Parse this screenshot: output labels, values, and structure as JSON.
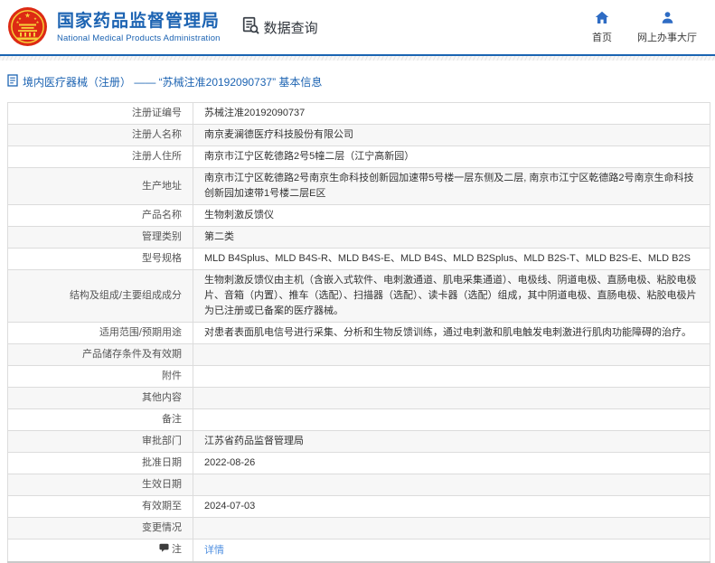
{
  "header": {
    "org_name_cn": "国家药品监督管理局",
    "org_name_en": "National Medical Products Administration",
    "app_title": "数据查询",
    "nav_home_label": "首页",
    "nav_hall_label": "网上办事大厅"
  },
  "breadcrumb": {
    "text": "境内医疗器械（注册） —— “苏械注准20192090737” 基本信息"
  },
  "table": {
    "rows": [
      {
        "label": "注册证编号",
        "value": "苏械注准20192090737"
      },
      {
        "label": "注册人名称",
        "value": "南京麦澜德医疗科技股份有限公司"
      },
      {
        "label": "注册人住所",
        "value": "南京市江宁区乾德路2号5幢二层（江宁高新园）"
      },
      {
        "label": "生产地址",
        "value": "南京市江宁区乾德路2号南京生命科技创新园加速带5号楼一层东侧及二层, 南京市江宁区乾德路2号南京生命科技创新园加速带1号楼二层E区"
      },
      {
        "label": "产品名称",
        "value": "生物刺激反馈仪"
      },
      {
        "label": "管理类别",
        "value": "第二类"
      },
      {
        "label": "型号规格",
        "value": "MLD B4Splus、MLD B4S-R、MLD B4S-E、MLD B4S、MLD B2Splus、MLD B2S-T、MLD B2S-E、MLD B2S"
      },
      {
        "label": "结构及组成/主要组成成分",
        "value": "生物刺激反馈仪由主机（含嵌入式软件、电刺激通道、肌电采集通道）、电极线、阴道电极、直肠电极、粘胶电极片、音箱（内置）、推车（选配）、扫描器（选配）、读卡器（选配）组成，其中阴道电极、直肠电极、粘胶电极片为已注册或已备案的医疗器械。"
      },
      {
        "label": "适用范围/预期用途",
        "value": "对患者表面肌电信号进行采集、分析和生物反馈训练，通过电刺激和肌电触发电刺激进行肌肉功能障碍的治疗。"
      },
      {
        "label": "产品储存条件及有效期",
        "value": ""
      },
      {
        "label": "附件",
        "value": ""
      },
      {
        "label": "其他内容",
        "value": ""
      },
      {
        "label": "备注",
        "value": ""
      },
      {
        "label": "审批部门",
        "value": "江苏省药品监督管理局"
      },
      {
        "label": "批准日期",
        "value": "2022-08-26"
      },
      {
        "label": "生效日期",
        "value": ""
      },
      {
        "label": "有效期至",
        "value": "2024-07-03"
      },
      {
        "label": "变更情况",
        "value": ""
      },
      {
        "label": "注",
        "value": "详情",
        "link": true,
        "icon": "note-icon"
      }
    ]
  },
  "colors": {
    "brand_blue": "#1c63b2",
    "icon_blue": "#2e6cc4",
    "link_blue": "#4f8fe0",
    "row_alt_bg": "#f7f7f7",
    "border_gray": "#dcdcdc",
    "emblem_red": "#dd2a14",
    "emblem_gold": "#f6cf3a"
  }
}
